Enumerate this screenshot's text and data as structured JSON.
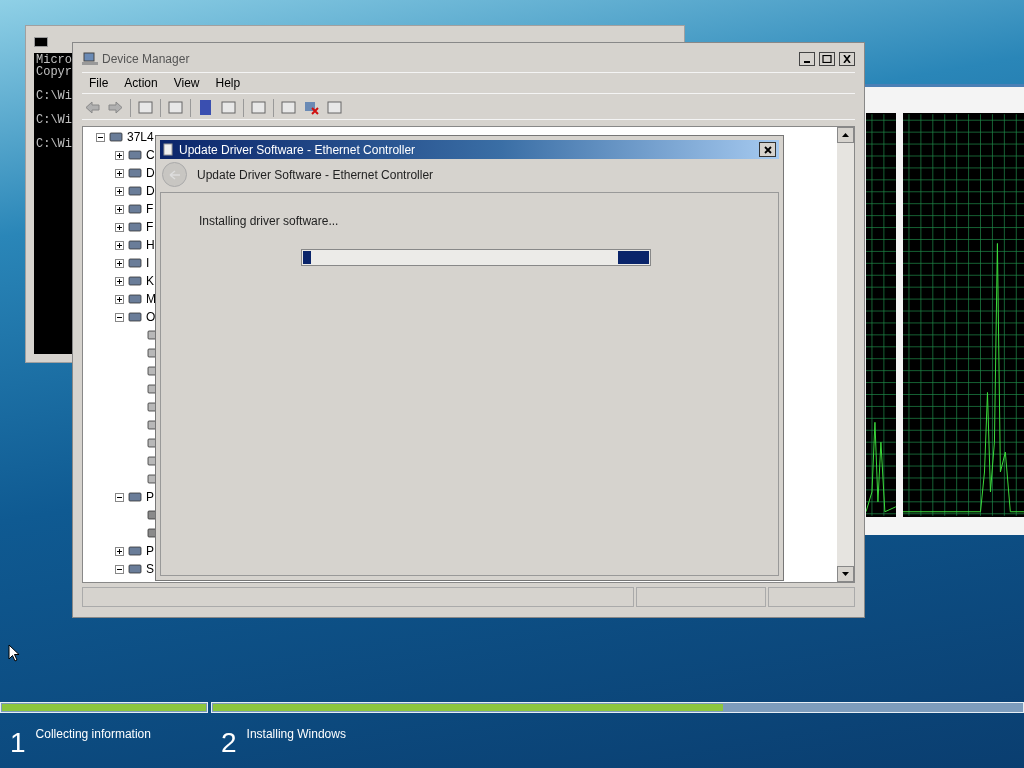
{
  "cmd_window": {
    "header_lines": [
      "Micro",
      "Copyr"
    ],
    "prompts": [
      "C:\\Wi",
      "C:\\Wi",
      "C:\\Wi"
    ]
  },
  "device_manager": {
    "title": "Device Manager",
    "menu": [
      "File",
      "Action",
      "View",
      "Help"
    ],
    "tree": {
      "label": "37L4",
      "expanded": true,
      "children": [
        {
          "label": "C",
          "expanded": false
        },
        {
          "label": "D",
          "expanded": false
        },
        {
          "label": "D",
          "expanded": false
        },
        {
          "label": "F",
          "expanded": false
        },
        {
          "label": "F",
          "expanded": false
        },
        {
          "label": "H",
          "expanded": false
        },
        {
          "label": "I",
          "expanded": false
        },
        {
          "label": "K",
          "expanded": false
        },
        {
          "label": "M",
          "expanded": false
        },
        {
          "label": "O",
          "expanded": true,
          "children": [
            {
              "kind": "device"
            },
            {
              "kind": "device"
            },
            {
              "kind": "device"
            },
            {
              "kind": "device"
            },
            {
              "kind": "device"
            },
            {
              "kind": "device"
            },
            {
              "kind": "device"
            },
            {
              "kind": "device"
            },
            {
              "kind": "device"
            }
          ]
        },
        {
          "label": "P",
          "expanded": true,
          "children": [
            {
              "kind": "port"
            },
            {
              "kind": "port"
            }
          ]
        },
        {
          "label": "P",
          "expanded": false
        },
        {
          "label": "S",
          "expanded": true
        }
      ]
    }
  },
  "dialog": {
    "title": "Update Driver Software - Ethernet Controller",
    "header": "Update Driver Software - Ethernet Controller",
    "status": "Installing driver software...",
    "progress": {
      "busy": true
    }
  },
  "setup_steps": [
    {
      "number": "1",
      "label": "Collecting information",
      "level": 1
    },
    {
      "number": "2",
      "label": "Installing Windows",
      "level": 0.63
    }
  ]
}
